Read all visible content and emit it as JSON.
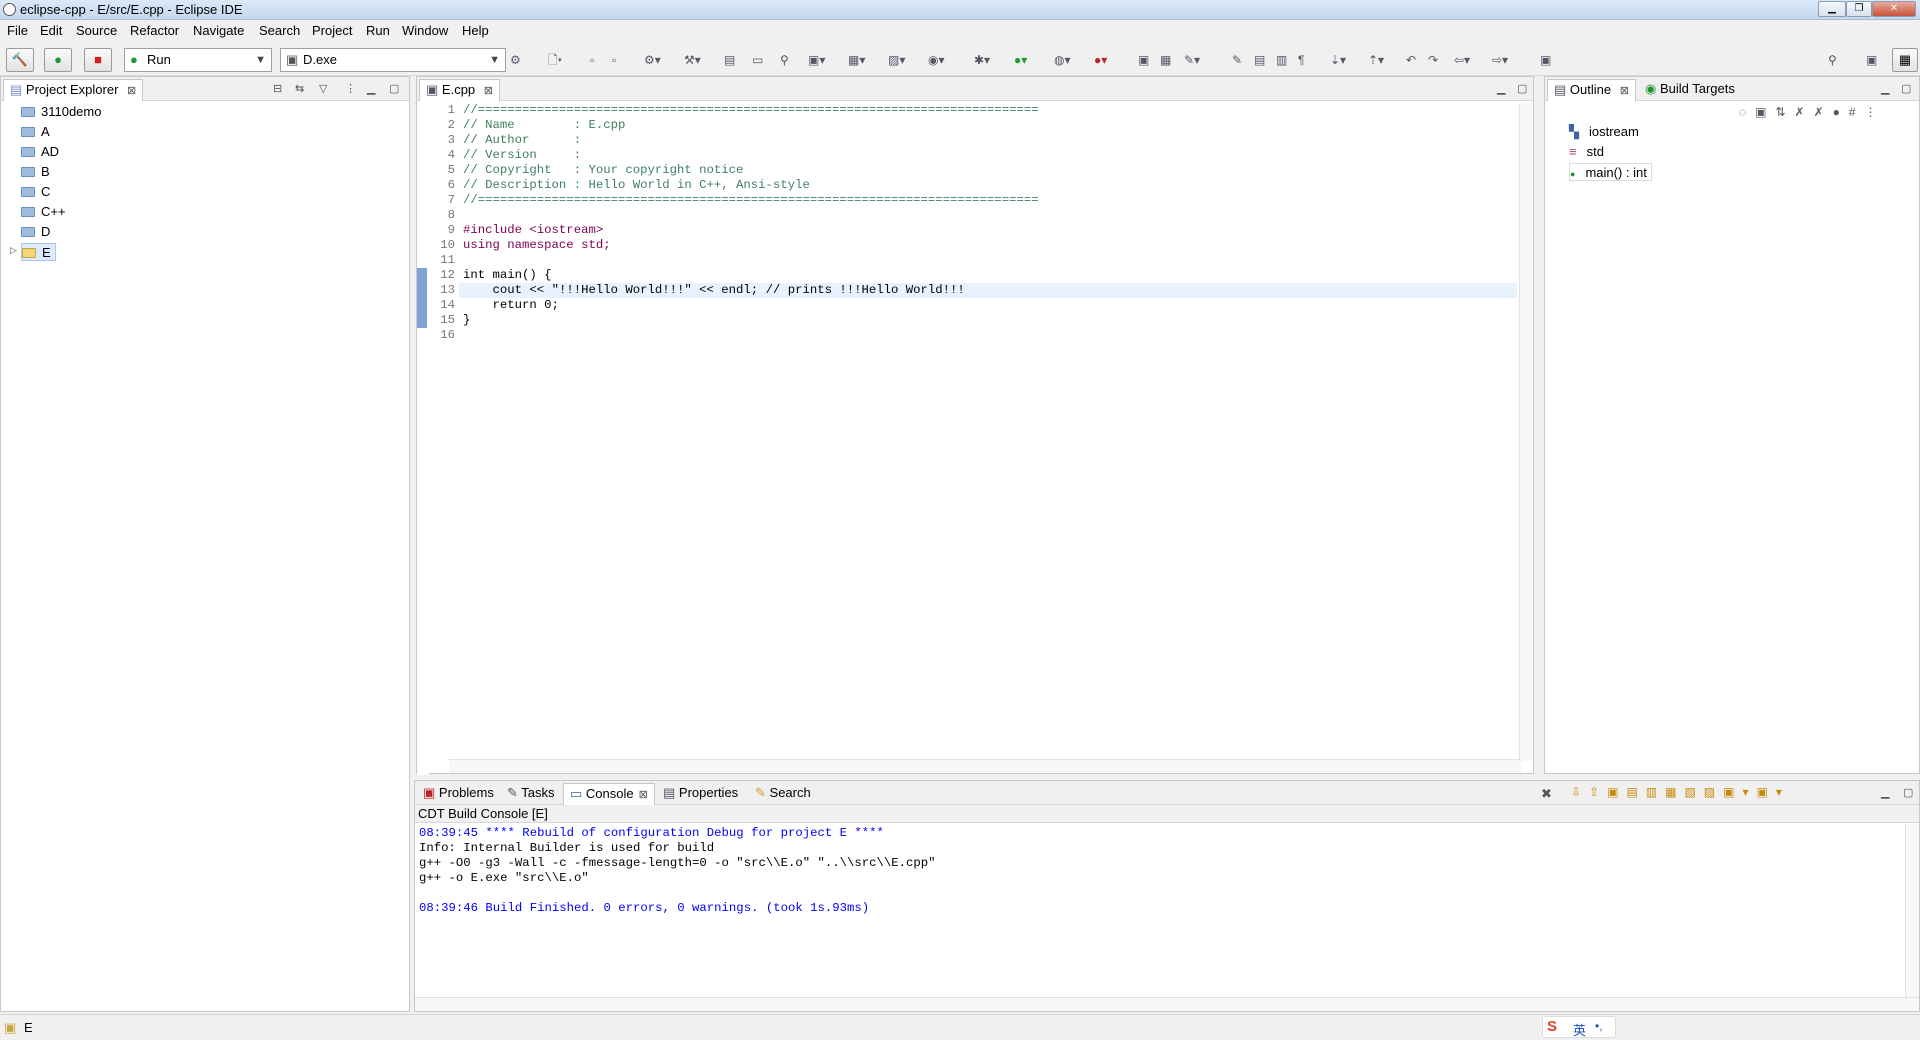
{
  "window": {
    "title": "eclipse-cpp - E/src/E.cpp - Eclipse IDE"
  },
  "menu": [
    "File",
    "Edit",
    "Source",
    "Refactor",
    "Navigate",
    "Search",
    "Project",
    "Run",
    "Window",
    "Help"
  ],
  "toolbar": {
    "launch_mode": "Run",
    "launch_target": "D.exe"
  },
  "project_explorer": {
    "title": "Project Explorer",
    "items": [
      "3110demo",
      "A",
      "AD",
      "B",
      "C",
      "C++",
      "D",
      "E"
    ],
    "selected": "E"
  },
  "editor": {
    "tab": "E.cpp",
    "lines": [
      "//============================================================================",
      "// Name        : E.cpp",
      "// Author      : ",
      "// Version     : ",
      "// Copyright   : Your copyright notice",
      "// Description : Hello World in C++, Ansi-style",
      "//============================================================================",
      "",
      "#include <iostream>",
      "using namespace std;",
      "",
      "int main() {",
      "\tcout << \"!!!Hello World!!!\" << endl; // prints !!!Hello World!!!",
      "\treturn 0;",
      "}",
      ""
    ],
    "line_numbers": [
      "1",
      "2",
      "3",
      "4",
      "5",
      "6",
      "7",
      "8",
      "9",
      "10",
      "11",
      "12",
      "13",
      "14",
      "15",
      "16"
    ]
  },
  "outline": {
    "tabs": [
      "Outline",
      "Build Targets"
    ],
    "items": [
      "iostream",
      "std",
      "main() : int"
    ]
  },
  "bottom": {
    "tabs": [
      "Problems",
      "Tasks",
      "Console",
      "Properties",
      "Search"
    ],
    "console_title": "CDT Build Console [E]",
    "console_lines": [
      "08:39:45 **** Rebuild of configuration Debug for project E ****",
      "Info: Internal Builder is used for build",
      "g++ -O0 -g3 -Wall -c -fmessage-length=0 -o \"src\\\\E.o\" \"..\\\\src\\\\E.cpp\"",
      "g++ -o E.exe \"src\\\\E.o\"",
      "",
      "08:39:46 Build Finished. 0 errors, 0 warnings. (took 1s.93ms)"
    ]
  },
  "statusbar": {
    "text": "E",
    "ime": "英"
  }
}
